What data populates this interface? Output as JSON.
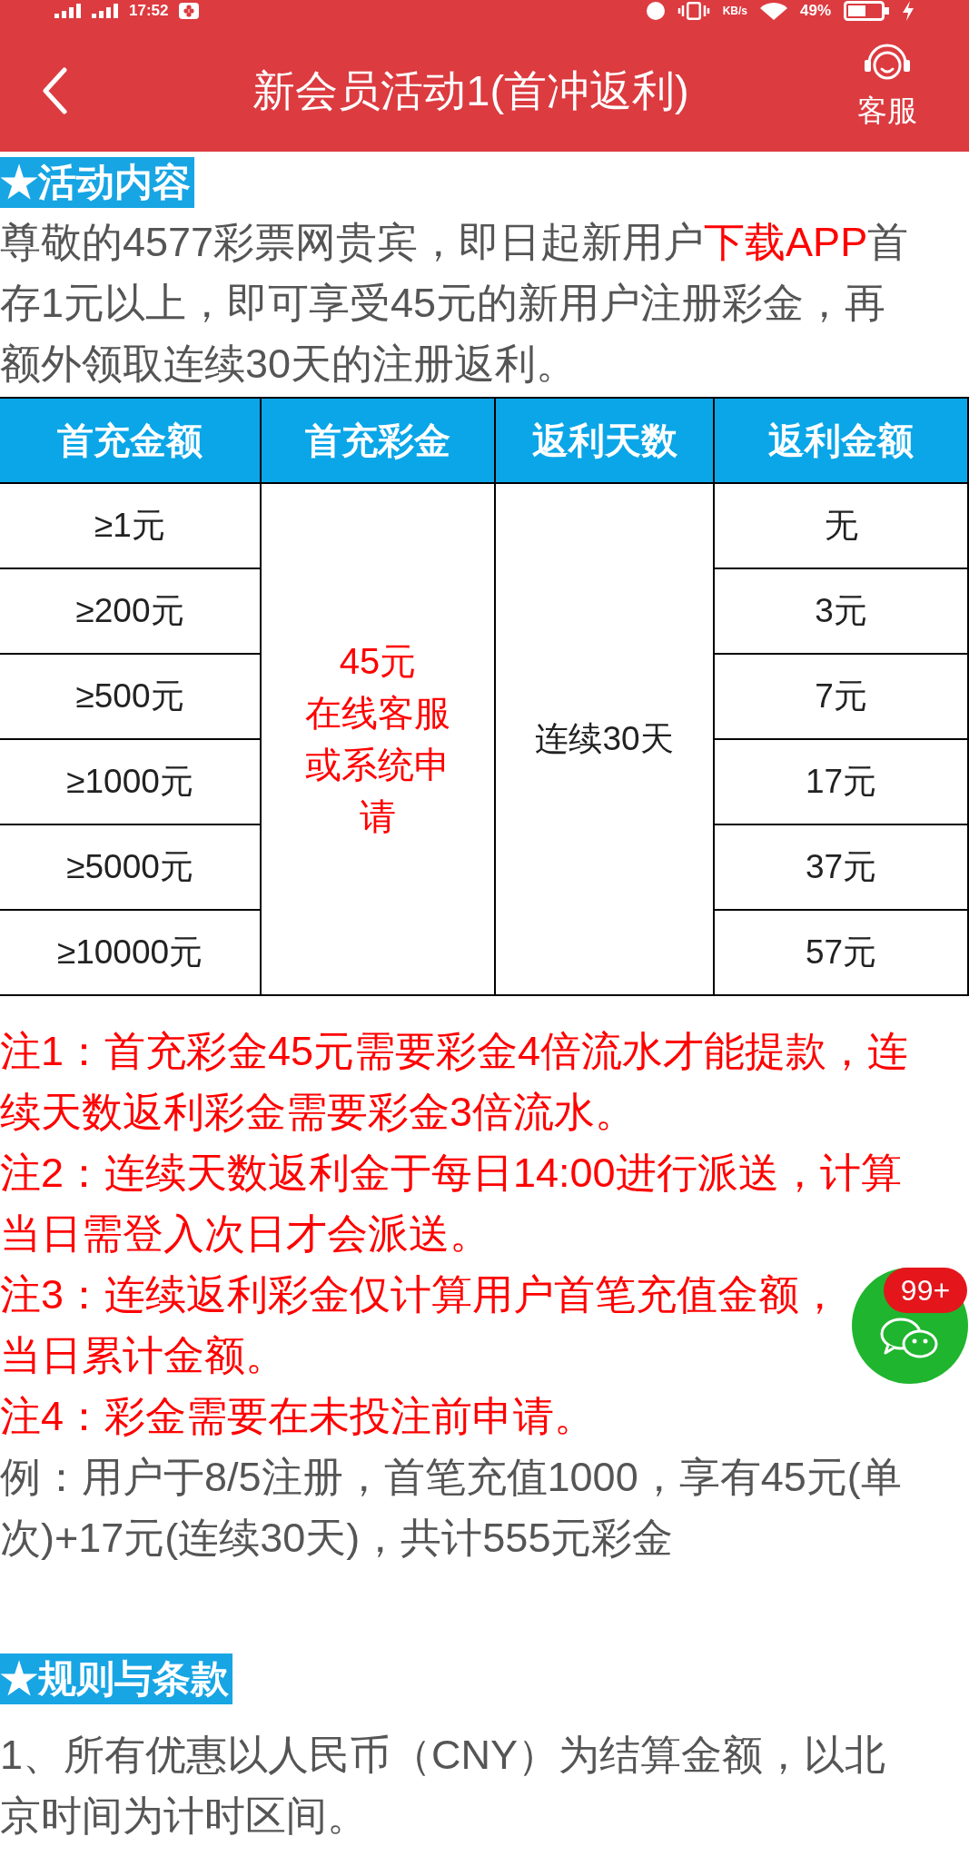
{
  "status_bar": {
    "time": "17:52",
    "speed_unit": "KB/s",
    "battery": "49%",
    "charging": true
  },
  "header": {
    "title": "新会员活动1(首冲返利)",
    "service_label": "客服"
  },
  "activity": {
    "heading": "★活动内容",
    "intro": [
      {
        "text": "尊敬的4577彩票网贵宾，即日起新用户",
        "emphasis": false
      },
      {
        "text": "下载APP",
        "emphasis": true
      },
      {
        "text": "首存1元以上，即可享受45元的新用户注册彩金，再额外领取连续30天的注册返利。",
        "emphasis": false
      }
    ],
    "table": {
      "columns": [
        "首充金额",
        "首充彩金",
        "返利天数",
        "返利金额"
      ],
      "rows": [
        {
          "deposit": "≥1元",
          "rebate": "无"
        },
        {
          "deposit": "≥200元",
          "rebate": "3元"
        },
        {
          "deposit": "≥500元",
          "rebate": "7元"
        },
        {
          "deposit": "≥1000元",
          "rebate": "17元"
        },
        {
          "deposit": "≥5000元",
          "rebate": "37元"
        },
        {
          "deposit": "≥10000元",
          "rebate": "57元"
        }
      ],
      "bonus_lines": [
        "45元",
        "在线客服或系统申请"
      ],
      "days": "连续30天"
    },
    "notes": [
      {
        "kind": "warning",
        "parts": [
          "注1：首充彩金45元需要彩金4倍流水才能提款，连续天数返利彩金需要彩金3倍流水。"
        ]
      },
      {
        "kind": "warning",
        "parts": [
          "注2：连续天数返利金于每日14:00进行派送，计算当日需登入次日才会派送。"
        ]
      },
      {
        "kind": "warning",
        "parts": [
          "注3：连续返利彩金仅计算用户首笔充值金额，",
          "当日累计金额。"
        ]
      },
      {
        "kind": "warning",
        "parts": [
          "注4：彩金需要在未投注前申请。"
        ]
      },
      {
        "kind": "example",
        "parts": [
          "例：用户于8/5注册，首笔充值1000，享有45元(单次)+17元(连续30天)，共计555元彩金"
        ]
      }
    ]
  },
  "rules": {
    "heading": "★规则与条款",
    "items": [
      "1、所有优惠以人民币（CNY）为结算金额，以北京时间为计时区间。"
    ]
  },
  "chat_button": {
    "badge": "99+"
  }
}
